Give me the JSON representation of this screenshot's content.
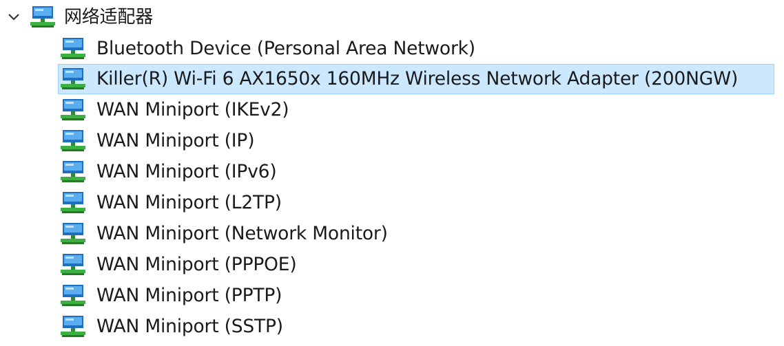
{
  "tree": {
    "category": {
      "label": "网络适配器",
      "icon": "network-adapter-icon",
      "expanded": true
    },
    "items": [
      {
        "label": "Bluetooth Device (Personal Area Network)",
        "icon": "network-adapter-icon",
        "selected": false
      },
      {
        "label": "Killer(R) Wi-Fi 6 AX1650x 160MHz Wireless Network Adapter (200NGW)",
        "icon": "network-adapter-icon",
        "selected": true
      },
      {
        "label": "WAN Miniport (IKEv2)",
        "icon": "network-adapter-icon",
        "selected": false
      },
      {
        "label": "WAN Miniport (IP)",
        "icon": "network-adapter-icon",
        "selected": false
      },
      {
        "label": "WAN Miniport (IPv6)",
        "icon": "network-adapter-icon",
        "selected": false
      },
      {
        "label": "WAN Miniport (L2TP)",
        "icon": "network-adapter-icon",
        "selected": false
      },
      {
        "label": "WAN Miniport (Network Monitor)",
        "icon": "network-adapter-icon",
        "selected": false
      },
      {
        "label": "WAN Miniport (PPPOE)",
        "icon": "network-adapter-icon",
        "selected": false
      },
      {
        "label": "WAN Miniport (PPTP)",
        "icon": "network-adapter-icon",
        "selected": false
      },
      {
        "label": "WAN Miniport (SSTP)",
        "icon": "network-adapter-icon",
        "selected": false
      }
    ]
  },
  "colors": {
    "selection_background": "#cce8ff",
    "selection_border": "#99d1ff",
    "icon_screen": "#1e7fd6",
    "icon_base": "#3cb043"
  }
}
